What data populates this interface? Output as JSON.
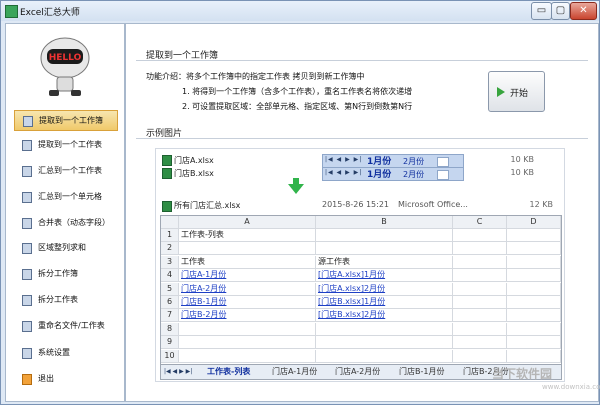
{
  "window": {
    "title": "Excel汇总大师"
  },
  "titlebar_controls": {
    "minimize": "▭",
    "maximize": "▢",
    "close": "✕"
  },
  "sidebar": {
    "items": [
      {
        "label": "提取到一个工作簿",
        "icon": "doc-icon",
        "active": true
      },
      {
        "label": "提取到一个工作表",
        "icon": "doc-icon"
      },
      {
        "label": "汇总到一个工作表",
        "icon": "doc-icon"
      },
      {
        "label": "汇总到一个单元格",
        "icon": "doc-icon"
      },
      {
        "label": "合并表（动态字段）",
        "icon": "sum-icon"
      },
      {
        "label": "区域整列求和",
        "icon": "sum-icon"
      },
      {
        "label": "拆分工作簿",
        "icon": "split-icon"
      },
      {
        "label": "拆分工作表",
        "icon": "split-icon"
      },
      {
        "label": "重命名文件/工作表",
        "icon": "rename-icon"
      },
      {
        "label": "系统设置",
        "icon": "gear-icon"
      },
      {
        "label": "退出",
        "icon": "exit-icon"
      }
    ]
  },
  "main": {
    "section_title": "提取到一个工作簿",
    "description": {
      "intro": "功能介绍：将多个工作簿中的指定工作表 拷贝到到新工作簿中",
      "point1": "1. 将得到一个工作簿（含多个工作表），重名工作表名将依次递增",
      "point2": "2. 可设置提取区域：全部单元格、指定区域、第N行到倒数第N行"
    },
    "start_button": "开始",
    "example_title": "示例图片"
  },
  "example": {
    "files": [
      {
        "name": "门店A.xlsx",
        "size": "10 KB",
        "tab_nav": "|◀ ◀ ▶ ▶|",
        "tab_active": "1月份",
        "tab_other": "2月份"
      },
      {
        "name": "门店B.xlsx",
        "size": "10 KB",
        "tab_nav": "|◀ ◀ ▶ ▶|",
        "tab_active": "1月份",
        "tab_other": "2月份"
      }
    ],
    "merged": {
      "name": "所有门店汇总.xlsx",
      "date": "2015-8-26 15:21",
      "type": "Microsoft Office...",
      "size": "12 KB"
    },
    "sheet": {
      "col_headers": [
        "A",
        "B",
        "C",
        "D"
      ],
      "rows": [
        {
          "no": "1",
          "a": "工作表-列表",
          "b": "",
          "a_link": false,
          "b_link": false
        },
        {
          "no": "2",
          "a": "",
          "b": "",
          "a_link": false,
          "b_link": false
        },
        {
          "no": "3",
          "a": "工作表",
          "b": "源工作表",
          "a_link": false,
          "b_link": false
        },
        {
          "no": "4",
          "a": "门店A-1月份",
          "b": "[门店A.xlsx]1月份",
          "a_link": true,
          "b_link": true
        },
        {
          "no": "5",
          "a": "门店A-2月份",
          "b": "[门店A.xlsx]2月份",
          "a_link": true,
          "b_link": true
        },
        {
          "no": "6",
          "a": "门店B-1月份",
          "b": "[门店B.xlsx]1月份",
          "a_link": true,
          "b_link": true
        },
        {
          "no": "7",
          "a": "门店B-2月份",
          "b": "[门店B.xlsx]2月份",
          "a_link": true,
          "b_link": true
        },
        {
          "no": "8",
          "a": "",
          "b": "",
          "a_link": false,
          "b_link": false
        },
        {
          "no": "9",
          "a": "",
          "b": "",
          "a_link": false,
          "b_link": false
        },
        {
          "no": "10",
          "a": "",
          "b": "",
          "a_link": false,
          "b_link": false
        }
      ],
      "tabs": [
        "工作表-列表",
        "门店A-1月份",
        "门店A-2月份",
        "门店B-1月份",
        "门店B-2月份"
      ],
      "tab_nav": "|◀ ◀ ▶ ▶|"
    }
  },
  "watermark": {
    "main": "当下软件园",
    "sub": "www.downxia.com"
  },
  "colors": {
    "accent": "#31b44b",
    "link": "#1d3fc5",
    "active_nav": "#f0c96a"
  }
}
